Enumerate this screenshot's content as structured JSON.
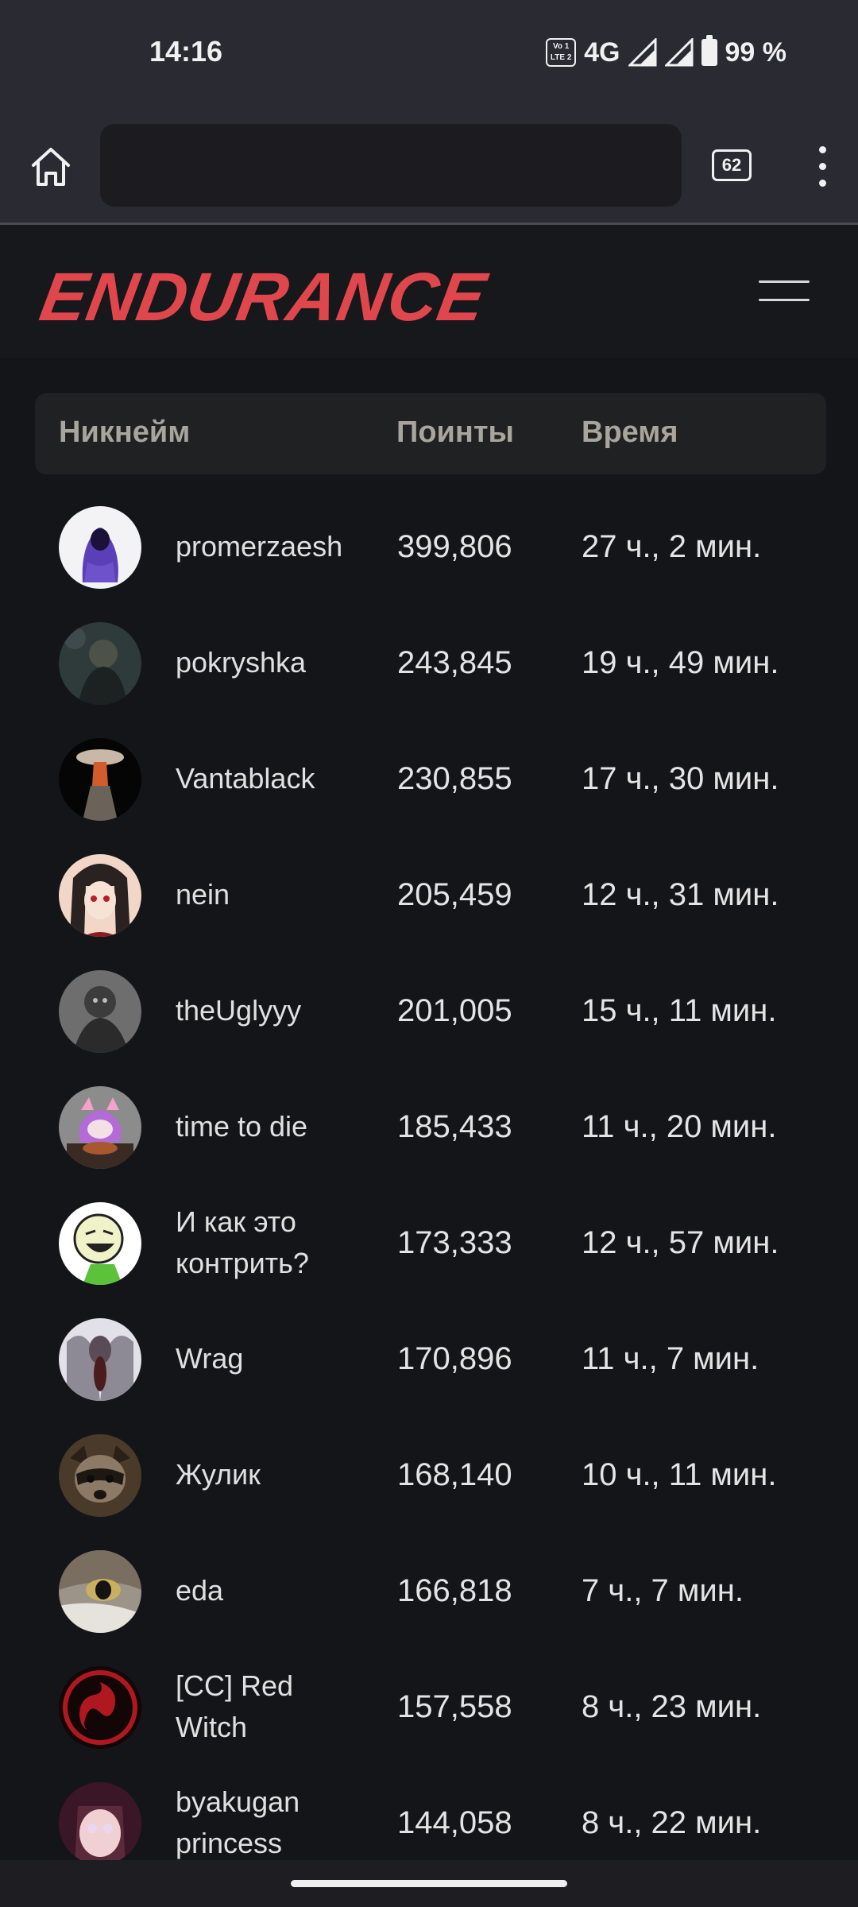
{
  "status_bar": {
    "time": "14:16",
    "volte_badge": "Vo LTE 1 2",
    "network": "4G",
    "battery": "99 %"
  },
  "browser": {
    "tab_count": "62",
    "url": ""
  },
  "site": {
    "logo": "ENDURANCE",
    "accent_color": "#e0474c"
  },
  "table": {
    "headers": {
      "nickname": "Никнейм",
      "points": "Поинты",
      "time": "Время"
    },
    "rows": [
      {
        "nickname": "promerzaesh",
        "points": "399,806",
        "time": "27 ч., 2 мин.",
        "avatar": "purple-hooded-figure"
      },
      {
        "nickname": "pokryshka",
        "points": "243,845",
        "time": "19 ч., 49 мин.",
        "avatar": "dark-figure"
      },
      {
        "nickname": "Vantablack",
        "points": "230,855",
        "time": "17 ч., 30 мин.",
        "avatar": "mushroom-explosion"
      },
      {
        "nickname": "nein",
        "points": "205,459",
        "time": "12 ч., 31 мин.",
        "avatar": "anime-girl"
      },
      {
        "nickname": "theUglyyy",
        "points": "201,005",
        "time": "15 ч., 11 мин.",
        "avatar": "grey-creature"
      },
      {
        "nickname": "time to die",
        "points": "185,433",
        "time": "11 ч., 20 мин.",
        "avatar": "pink-cat-girl"
      },
      {
        "nickname": "И как это контрить?",
        "points": "173,333",
        "time": "12 ч., 57 мин.",
        "avatar": "laughing-face"
      },
      {
        "nickname": "Wrag",
        "points": "170,896",
        "time": "11 ч., 7 мин.",
        "avatar": "screaming-demon"
      },
      {
        "nickname": "Жулик",
        "points": "168,140",
        "time": "10 ч., 11 мин.",
        "avatar": "raccoon"
      },
      {
        "nickname": "eda",
        "points": "166,818",
        "time": "7 ч., 7 мин.",
        "avatar": "cat-eye"
      },
      {
        "nickname": "[CC] Red Witch",
        "points": "157,558",
        "time": "8 ч., 23 мин.",
        "avatar": "red-dragon-emblem"
      },
      {
        "nickname": "byakugan princess",
        "points": "144,058",
        "time": "8 ч., 22 мин.",
        "avatar": "anime-girl-dark-hair"
      }
    ]
  }
}
